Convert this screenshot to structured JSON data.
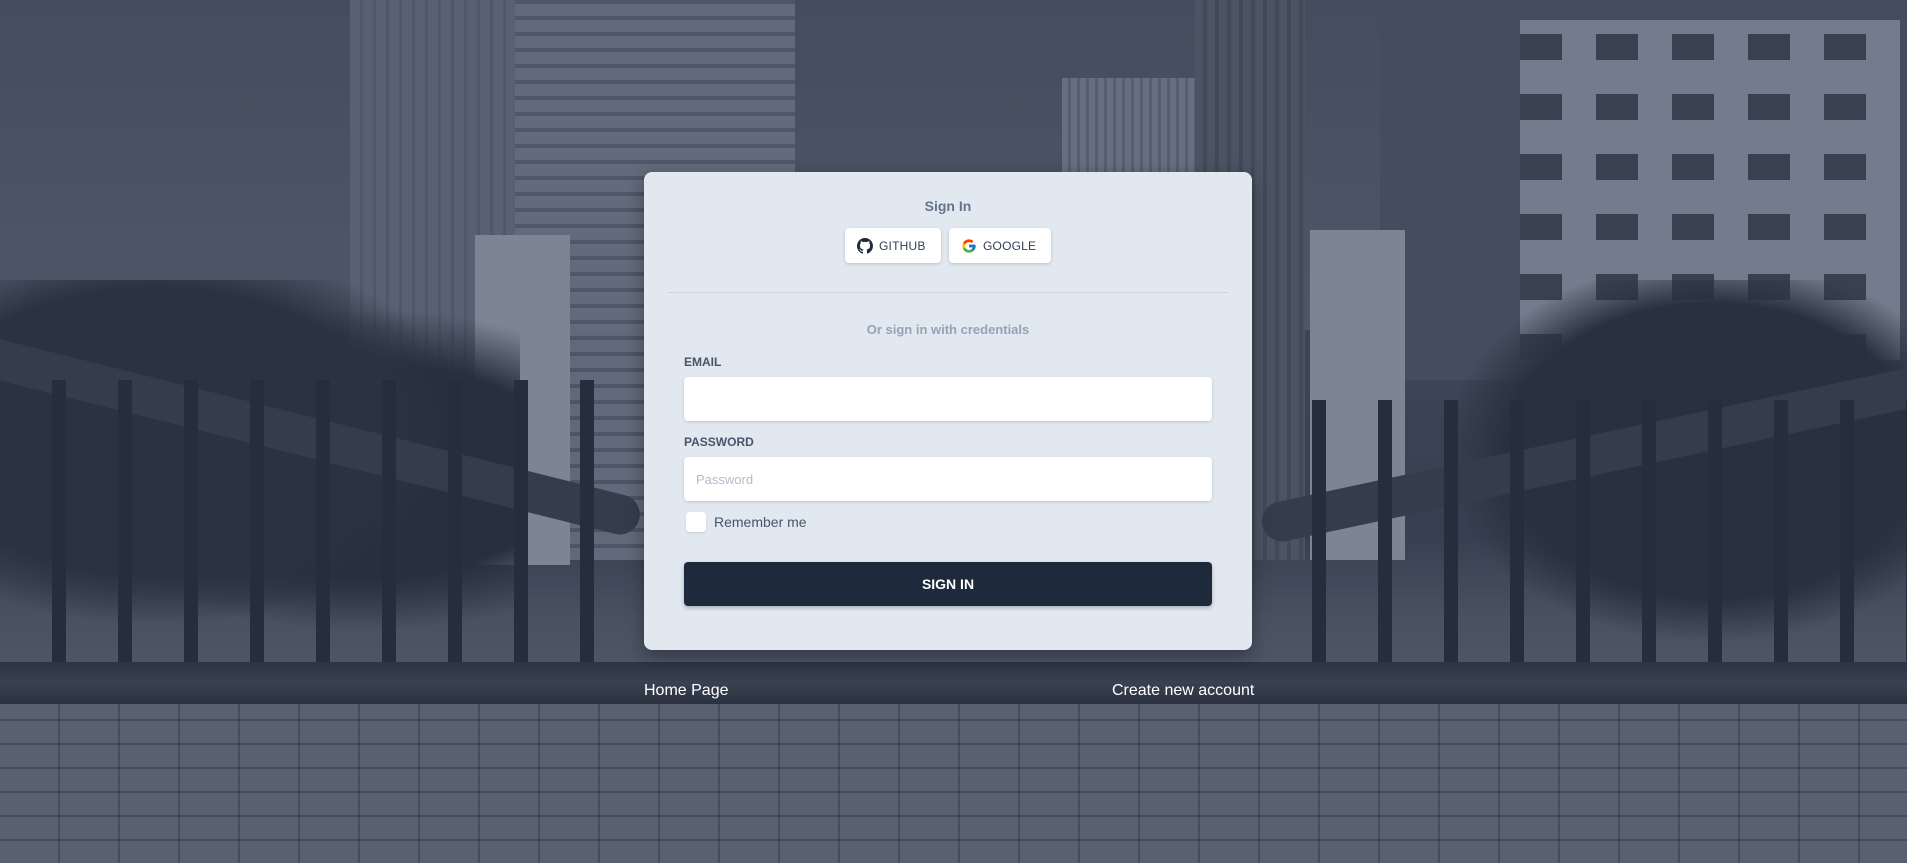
{
  "card": {
    "title": "Sign In",
    "social": {
      "github_label": "GITHUB",
      "google_label": "GOOGLE"
    },
    "subtitle": "Or sign in with credentials",
    "email": {
      "label": "EMAIL",
      "value": "",
      "placeholder": ""
    },
    "password": {
      "label": "PASSWORD",
      "value": "",
      "placeholder": "Password"
    },
    "remember": {
      "label": "Remember me",
      "checked": false
    },
    "submit_label": "SIGN IN"
  },
  "footer": {
    "home_link": "Home Page",
    "create_link": "Create new account"
  },
  "colors": {
    "card_bg": "#e2e8f0",
    "button_dark": "#1e293b",
    "muted_text": "#94a3b8",
    "label_text": "#475569"
  },
  "icons": {
    "github": "github-icon",
    "google": "google-icon"
  }
}
